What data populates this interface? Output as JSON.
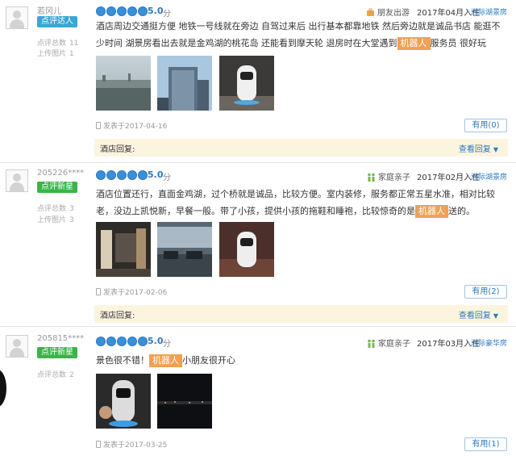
{
  "reviews": [
    {
      "user_name": "若冈儿",
      "badge": "点评达人",
      "stats": [
        {
          "label": "点评总数",
          "value": "11"
        },
        {
          "label": "上传图片",
          "value": "1"
        }
      ],
      "score": "5.0",
      "score_unit": "分",
      "trip_type": "朋友出游",
      "checkin": "2017年04月入住",
      "room_type": "洲际湖景房",
      "content_before": "酒店周边交通挺方便 地铁一号线就在旁边 自驾过来后 出行基本都靠地铁 然后旁边就是诚品书店 能逛不少时间 湖景房看出去就是金鸡湖的桃花岛 还能看到摩天轮 退房时在大堂遇到",
      "highlight": "机器人",
      "content_after": "服务员 很好玩",
      "posted": "发表于2017-04-16",
      "useful": "有用(0)",
      "reply_label": "酒店回复:",
      "reply_view": "查看回复"
    },
    {
      "user_name": "205226****",
      "badge": "点评新星",
      "stats": [
        {
          "label": "点评总数",
          "value": "3"
        },
        {
          "label": "上传图片",
          "value": "3"
        }
      ],
      "score": "5.0",
      "score_unit": "分",
      "trip_type": "家庭亲子",
      "checkin": "2017年02月入住",
      "room_type": "洲际湖景房",
      "content_before": "酒店位置还行，直面金鸡湖，过个桥就是诚品，比较方便。室内装修，服务都正常五星水准，相对比较老，没边上凯悦新，早餐一般。带了小孩，提供小孩的拖鞋和睡袍，比较惊奇的是",
      "highlight": "机器人",
      "content_after": "送的。",
      "posted": "发表于2017-02-06",
      "useful": "有用(2)",
      "reply_label": "酒店回复:",
      "reply_view": "查看回复"
    },
    {
      "user_name": "205815****",
      "badge": "点评新星",
      "stats": [
        {
          "label": "点评总数",
          "value": "2"
        }
      ],
      "score": "5.0",
      "score_unit": "分",
      "trip_type": "家庭亲子",
      "checkin": "2017年03月入住",
      "room_type": "洲际豪华房",
      "content_before": "景色很不错！",
      "highlight": "机器人",
      "content_after": "小朋友很开心",
      "posted": "发表于2017-03-25",
      "useful": "有用(1)"
    }
  ],
  "colors": {
    "accent": "#2b79c0",
    "highlight": "#f0a154",
    "reply_bg": "#fbf4df",
    "badge_blue": "#3aa6d6",
    "badge_green": "#39b548"
  },
  "icons": {
    "trip_friends": "luggage-icon",
    "trip_family": "family-icon",
    "posted": "phone-icon",
    "reply_toggle": "caret-down-icon"
  }
}
